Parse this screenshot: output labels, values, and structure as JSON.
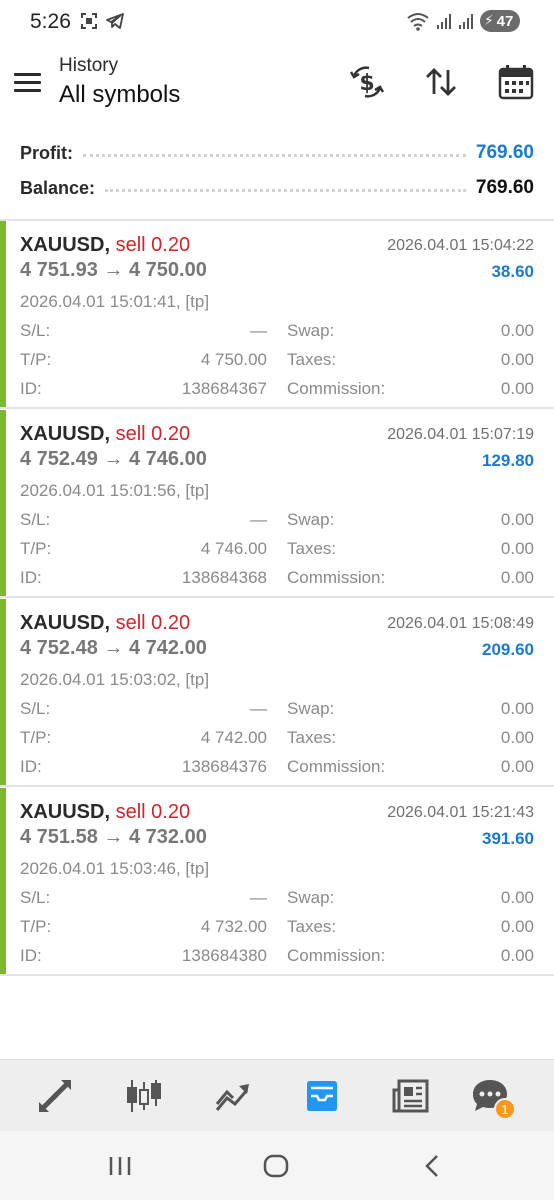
{
  "status_bar": {
    "time": "5:26",
    "battery_level": "47",
    "icons": [
      "screenshot-icon",
      "telegram-icon",
      "wifi-icon",
      "signal-icon",
      "signal-icon",
      "battery-charging-icon"
    ]
  },
  "header": {
    "subtitle": "History",
    "title": "All symbols",
    "actions": [
      "dollar-exchange-icon",
      "sort-icon",
      "calendar-icon"
    ]
  },
  "summary": {
    "profit_label": "Profit:",
    "profit_value": "769.60",
    "balance_label": "Balance:",
    "balance_value": "769.60"
  },
  "deals": [
    {
      "symbol": "XAUUSD,",
      "type": "sell 0.20",
      "close_time": "2026.04.01 15:04:22",
      "prices": "4 751.93 → 4 750.00",
      "profit": "38.60",
      "open_time": "2026.04.01 15:01:41, [tp]",
      "sl_label": "S/L:",
      "sl_value": "—",
      "swap_label": "Swap:",
      "swap_value": "0.00",
      "tp_label": "T/P:",
      "tp_value": "4 750.00",
      "taxes_label": "Taxes:",
      "taxes_value": "0.00",
      "id_label": "ID:",
      "id_value": "138684367",
      "commission_label": "Commission:",
      "commission_value": "0.00"
    },
    {
      "symbol": "XAUUSD,",
      "type": "sell 0.20",
      "close_time": "2026.04.01 15:07:19",
      "prices": "4 752.49 → 4 746.00",
      "profit": "129.80",
      "open_time": "2026.04.01 15:01:56, [tp]",
      "sl_label": "S/L:",
      "sl_value": "—",
      "swap_label": "Swap:",
      "swap_value": "0.00",
      "tp_label": "T/P:",
      "tp_value": "4 746.00",
      "taxes_label": "Taxes:",
      "taxes_value": "0.00",
      "id_label": "ID:",
      "id_value": "138684368",
      "commission_label": "Commission:",
      "commission_value": "0.00"
    },
    {
      "symbol": "XAUUSD,",
      "type": "sell 0.20",
      "close_time": "2026.04.01 15:08:49",
      "prices": "4 752.48 → 4 742.00",
      "profit": "209.60",
      "open_time": "2026.04.01 15:03:02, [tp]",
      "sl_label": "S/L:",
      "sl_value": "—",
      "swap_label": "Swap:",
      "swap_value": "0.00",
      "tp_label": "T/P:",
      "tp_value": "4 742.00",
      "taxes_label": "Taxes:",
      "taxes_value": "0.00",
      "id_label": "ID:",
      "id_value": "138684376",
      "commission_label": "Commission:",
      "commission_value": "0.00"
    },
    {
      "symbol": "XAUUSD,",
      "type": "sell 0.20",
      "close_time": "2026.04.01 15:21:43",
      "prices": "4 751.58 → 4 732.00",
      "profit": "391.60",
      "open_time": "2026.04.01 15:03:46, [tp]",
      "sl_label": "S/L:",
      "sl_value": "—",
      "swap_label": "Swap:",
      "swap_value": "0.00",
      "tp_label": "T/P:",
      "tp_value": "4 732.00",
      "taxes_label": "Taxes:",
      "taxes_value": "0.00",
      "id_label": "ID:",
      "id_value": "138684380",
      "commission_label": "Commission:",
      "commission_value": "0.00"
    }
  ],
  "bottom_nav": {
    "items": [
      "quotes-icon",
      "chart-icon",
      "trade-icon",
      "history-icon",
      "news-icon",
      "messages-icon"
    ],
    "active": "history-icon",
    "messages_badge": "1"
  },
  "system_nav": [
    "recent-apps-icon",
    "home-icon",
    "back-icon"
  ],
  "colors": {
    "accent_bar": "#7cb82f",
    "sell": "#d2242a",
    "profit": "#1a7ad1",
    "active_nav": "#2196f3"
  }
}
